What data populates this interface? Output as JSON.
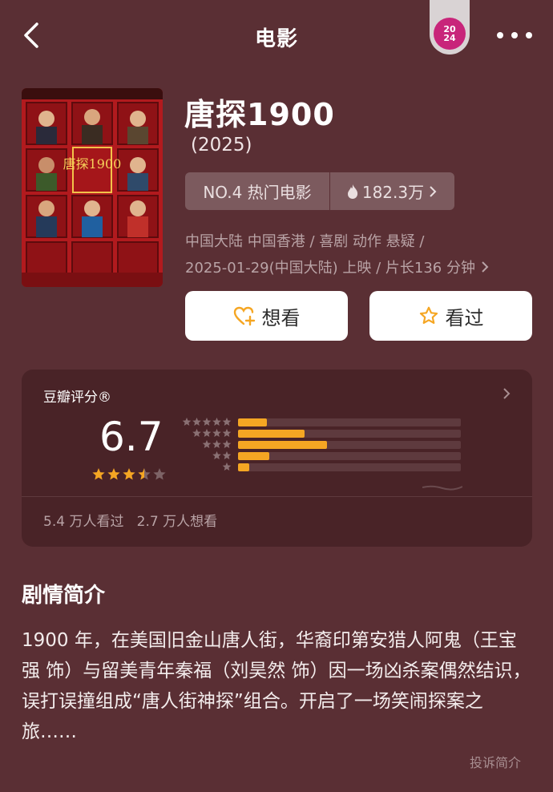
{
  "header": {
    "title": "电影",
    "badge_top": "20",
    "badge_bottom": "24"
  },
  "movie": {
    "title": "唐探1900",
    "year": "(2025)",
    "rank_label": "NO.4 热门电影",
    "heat": "182.3万",
    "meta_line1": "中国大陆 中国香港 / 喜剧 动作 悬疑 /",
    "meta_line2": "2025-01-29(中国大陆) 上映 / 片长136 分钟",
    "poster_title": "唐探1900"
  },
  "actions": {
    "want_label": "想看",
    "seen_label": "看过"
  },
  "rating": {
    "label": "豆瓣评分®",
    "score": "6.7",
    "stars": 3.5,
    "distribution": [
      {
        "stars": 5,
        "fraction": 0.13
      },
      {
        "stars": 4,
        "fraction": 0.3
      },
      {
        "stars": 3,
        "fraction": 0.4
      },
      {
        "stars": 2,
        "fraction": 0.14
      },
      {
        "stars": 1,
        "fraction": 0.05
      }
    ],
    "seen_count": "5.4 万人看过",
    "want_count": "2.7 万人想看"
  },
  "synopsis": {
    "title": "剧情简介",
    "text": "1900 年，在美国旧金山唐人街，华裔印第安猎人阿鬼（王宝强 饰）与留美青年秦福（刘昊然 饰）因一场凶杀案偶然结识，误打误撞组成“唐人街神探”组合。开启了一场笑闹探案之旅……",
    "report": "投诉简介"
  },
  "colors": {
    "background": "#5a2f34",
    "card": "#492327",
    "accent": "#f5a623"
  }
}
